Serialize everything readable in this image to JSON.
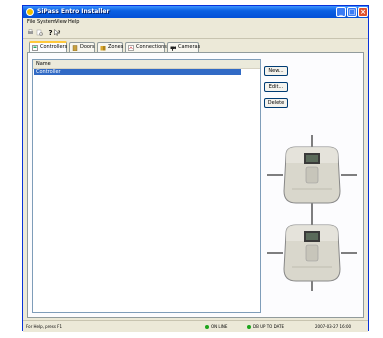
{
  "window": {
    "title": "SiPass Entro Installer"
  },
  "menu": [
    "File",
    "System",
    "View",
    "Help"
  ],
  "tabs": [
    {
      "label": "Controllers",
      "icon": "controller-icon",
      "active": true
    },
    {
      "label": "Doors",
      "icon": "door-icon",
      "active": false
    },
    {
      "label": "Zones",
      "icon": "zones-icon",
      "active": false
    },
    {
      "label": "Connections",
      "icon": "connections-icon",
      "active": false
    },
    {
      "label": "Cameras",
      "icon": "camera-icon",
      "active": false
    }
  ],
  "list": {
    "column": "Name",
    "rows": [
      "Controller"
    ]
  },
  "buttons": {
    "new": "New...",
    "edit": "Edit...",
    "delete": "Delete"
  },
  "status": {
    "help": "For Help, press F1",
    "online": "ON LINE",
    "uptodate": "DB UP TO DATE",
    "datetime": "2007-03-27 16:00"
  },
  "colors": {
    "titlebar": "#0a5fe2",
    "selection": "#316ac5",
    "status_ok": "#1da51d"
  }
}
